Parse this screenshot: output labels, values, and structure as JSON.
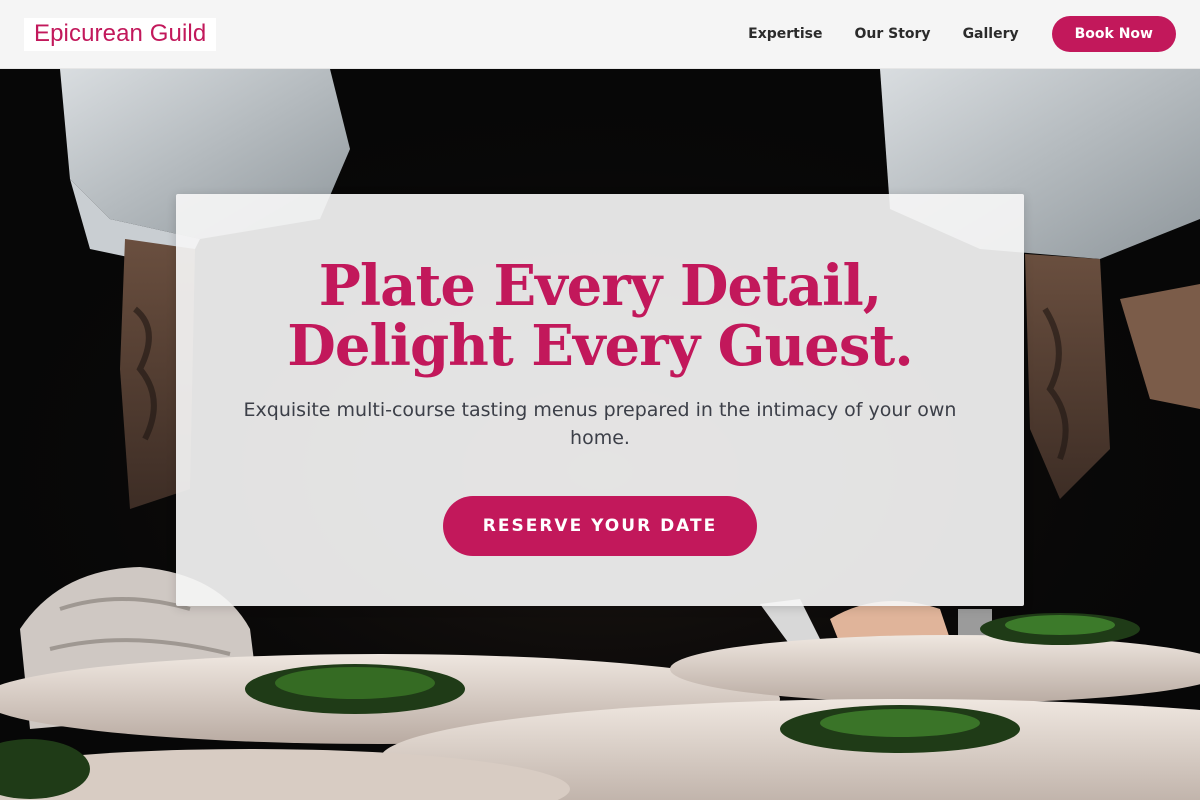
{
  "brand": {
    "name": "Epicurean Guild",
    "color": "#c2185b"
  },
  "nav": {
    "items": [
      {
        "label": "Expertise"
      },
      {
        "label": "Our Story"
      },
      {
        "label": "Gallery"
      }
    ],
    "book_label": "Book Now"
  },
  "hero": {
    "title_line1": "Plate Every Detail,",
    "title_line2": "Delight Every Guest.",
    "subtitle": "Exquisite multi-course tasting menus prepared in the intimacy of your own home.",
    "cta_label": "RESERVE YOUR DATE",
    "accent_color": "#c2185b"
  }
}
